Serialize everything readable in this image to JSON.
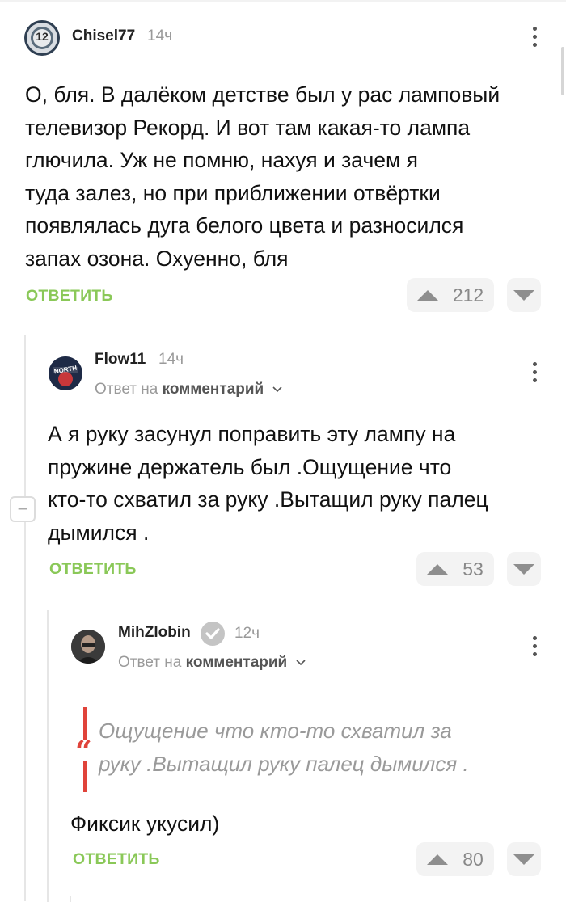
{
  "comments": [
    {
      "username": "Chisel77",
      "time": "14ч",
      "text_lines": [
        "О, бля. В далёком детстве был у рас ламповый",
        "телевизор Рекорд. И вот там какая-то лампа",
        "глючила. Уж не помню, нахуя и зачем я",
        "туда залез, но при приближении отвёртки",
        "появлялась дуга белого цвета и разносился",
        "запах озона. Охуенно, бля"
      ],
      "reply_label": "ОТВЕТИТЬ",
      "rating": "212",
      "avatar_badge": "12"
    },
    {
      "username": "Flow11",
      "time": "14ч",
      "reply_to_prefix": "Ответ на",
      "reply_to_target": "комментарий",
      "text_lines": [
        "А я руку засунул поправить эту лампу на",
        "пружине держатель был .Ощущение что",
        "кто-то схватил за руку .Вытащил руку палец",
        "дымился ."
      ],
      "reply_label": "ОТВЕТИТЬ",
      "rating": "53",
      "avatar_text": "NORTH"
    },
    {
      "username": "MihZlobin",
      "time": "12ч",
      "reply_to_prefix": "Ответ на",
      "reply_to_target": "комментарий",
      "quote_lines": [
        "Ощущение что кто-то схватил за",
        "руку .Вытащил руку палец дымился ."
      ],
      "text": "Фиксик укусил)",
      "reply_label": "ОТВЕТИТЬ",
      "rating": "80"
    }
  ],
  "collapse_symbol": "−",
  "colors": {
    "accent": "#8ac858",
    "muted": "#9a9a9a",
    "vote_bg": "#f3f3f3",
    "verified": "#c4c4c4"
  }
}
